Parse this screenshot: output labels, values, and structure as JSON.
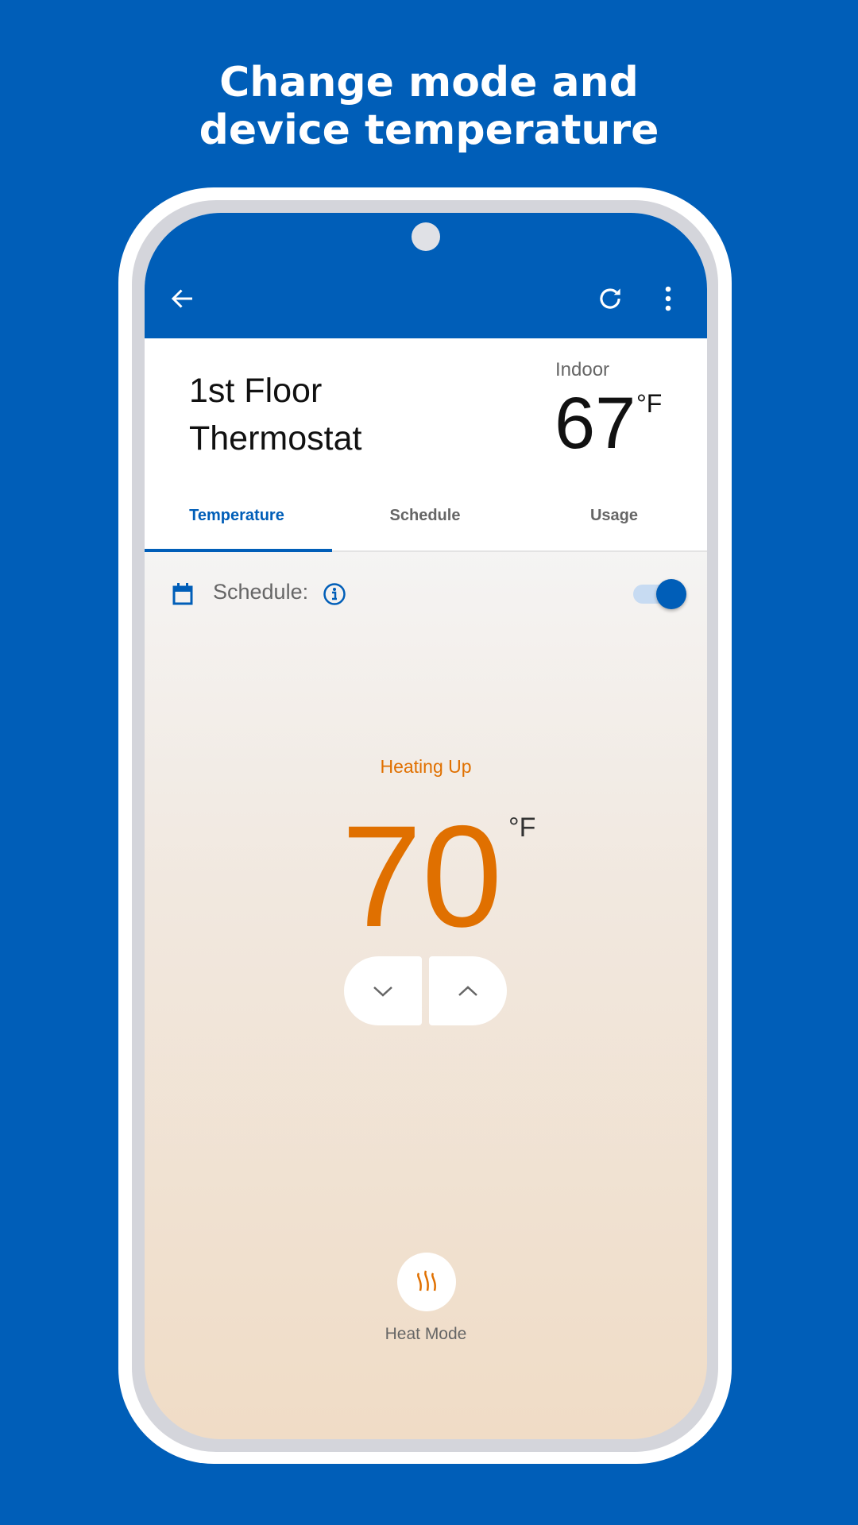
{
  "promo": {
    "line1": "Change mode and",
    "line2": "device temperature"
  },
  "device": {
    "name_line1": "1st Floor",
    "name_line2": "Thermostat"
  },
  "indoor": {
    "label": "Indoor",
    "temperature": "67",
    "unit": "°F"
  },
  "tabs": [
    {
      "label": "Temperature",
      "active": true
    },
    {
      "label": "Schedule",
      "active": false
    },
    {
      "label": "Usage",
      "active": false
    }
  ],
  "schedule": {
    "label": "Schedule:",
    "enabled": true
  },
  "thermostat": {
    "status": "Heating Up",
    "setpoint": "70",
    "unit": "°F"
  },
  "mode": {
    "label": "Heat Mode"
  },
  "colors": {
    "brand": "#005eb8",
    "heating": "#e07000"
  },
  "icons": [
    "back-arrow-icon",
    "refresh-icon",
    "more-vert-icon",
    "calendar-icon",
    "info-icon",
    "chevron-down-icon",
    "chevron-up-icon",
    "heat-icon"
  ]
}
